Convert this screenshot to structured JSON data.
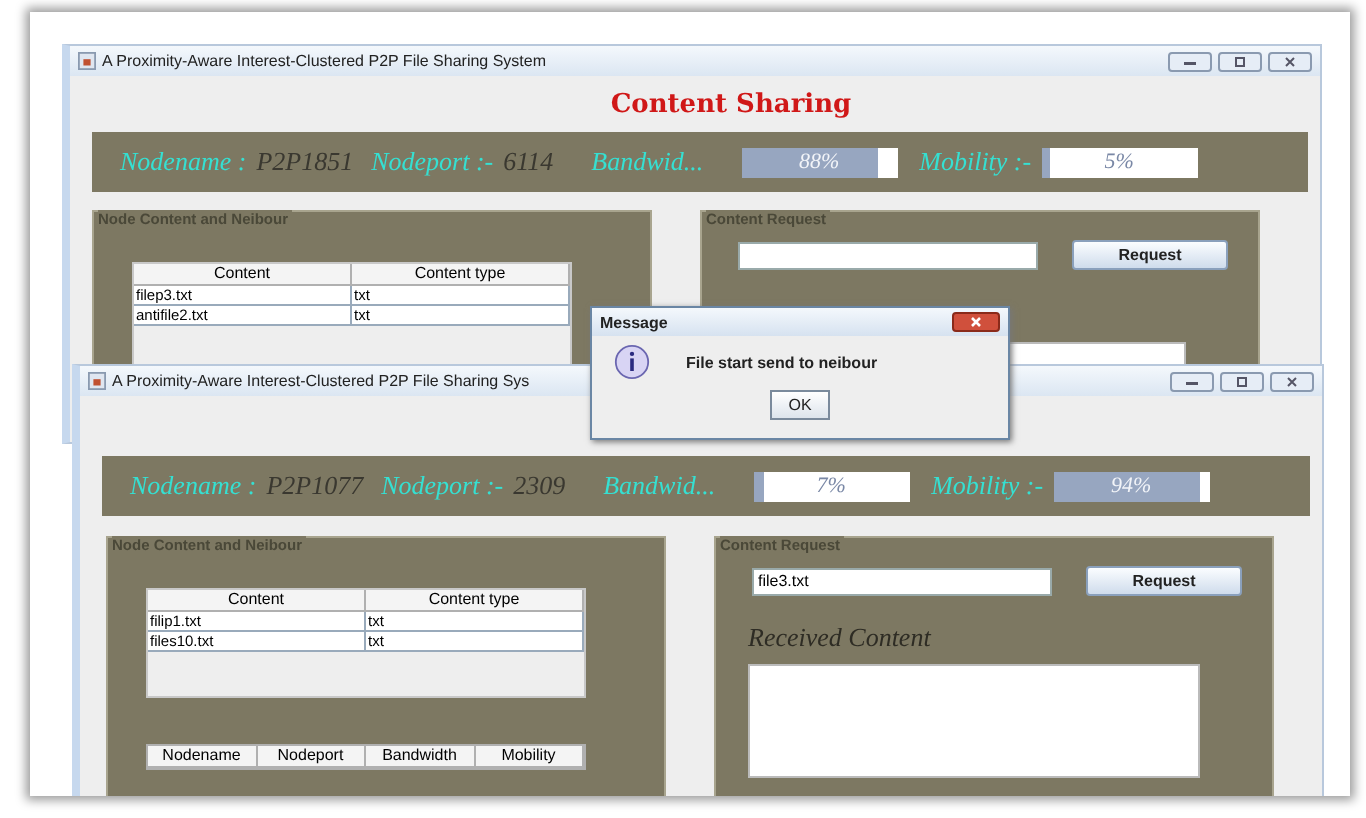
{
  "windows": [
    {
      "title": "A Proximity-Aware Interest-Clustered P2P File Sharing System",
      "heading": "Content Sharing",
      "node": {
        "name_label": "Nodename :",
        "name": "P2P1851",
        "port_label": "Nodeport :-",
        "port": "6114",
        "bandwidth_label": "Bandwid...",
        "bandwidth": {
          "reading": "88%",
          "level": 0.88
        },
        "mobility_label": "Mobility :-",
        "mobility": {
          "reading": "5%",
          "level": 0.05
        }
      },
      "content_panel": {
        "title": "Node Content and Neibour",
        "table": {
          "columns": [
            "Content",
            "Content type"
          ],
          "rows": [
            [
              "filep3.txt",
              "txt"
            ],
            [
              "antifile2.txt",
              "txt"
            ]
          ]
        }
      },
      "request_panel": {
        "title": "Content Request",
        "button": "Request"
      }
    },
    {
      "title": "A Proximity-Aware Interest-Clustered P2P File Sharing Sys",
      "node": {
        "name_label": "Nodename :",
        "name": "P2P1077",
        "port_label": "Nodeport :-",
        "port": "2309",
        "bandwidth_label": "Bandwid...",
        "bandwidth": {
          "reading": "7%",
          "level": 0.07
        },
        "mobility_label": "Mobility :-",
        "mobility": {
          "reading": "94%",
          "level": 0.94
        }
      },
      "content_panel": {
        "title": "Node Content and Neibour",
        "table": {
          "columns": [
            "Content",
            "Content type"
          ],
          "rows": [
            [
              "filip1.txt",
              "txt"
            ],
            [
              "files10.txt",
              "txt"
            ]
          ]
        },
        "neighbour_table": {
          "columns": [
            "Nodename",
            "Nodeport",
            "Bandwidth",
            "Mobility"
          ]
        }
      },
      "request_panel": {
        "title": "Content Request",
        "value": "file3.txt",
        "button": "Request",
        "received_label": "Received Content"
      }
    }
  ],
  "dialog": {
    "title": "Message",
    "message": "File start send to neibour",
    "button": "OK"
  }
}
